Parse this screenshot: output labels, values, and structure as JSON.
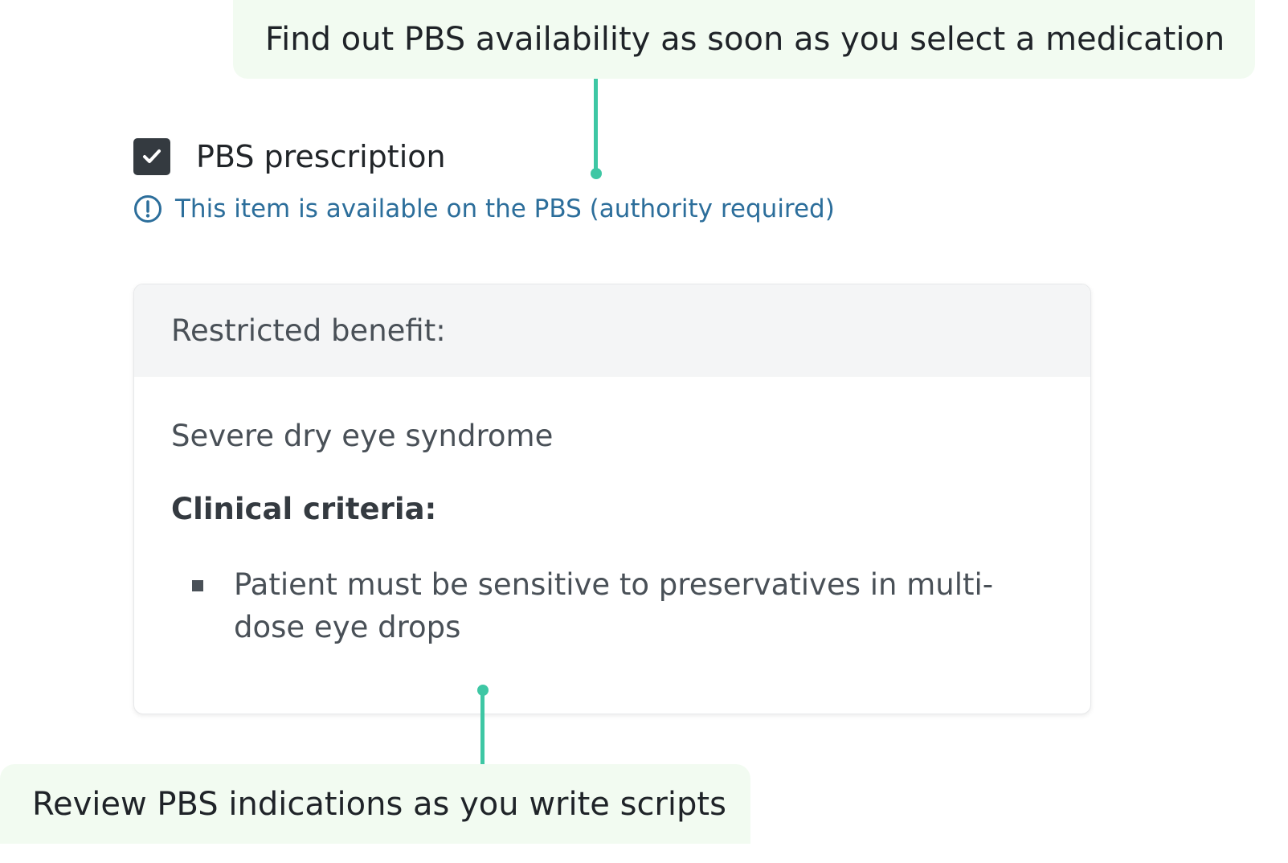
{
  "callouts": {
    "top": "Find out PBS availability as soon as you select a medication",
    "bottom": "Review PBS indications as you write scripts"
  },
  "colors": {
    "callout_bg": "#f2fbf1",
    "connector": "#3ec7a4",
    "info_text": "#2c6e9b",
    "checkbox": "#343a40"
  },
  "pbs": {
    "checkbox_label": "PBS prescription",
    "checked": true,
    "checkbox_icon": "check-icon",
    "availability_icon": "info-circle-icon",
    "availability_text": "This item is available on the PBS (authority required)"
  },
  "card": {
    "header": "Restricted benefit:",
    "condition": "Severe dry eye syndrome",
    "criteria_heading": "Clinical criteria:",
    "criteria": [
      "Patient must be sensitive to preservatives in multi-dose eye drops"
    ]
  }
}
